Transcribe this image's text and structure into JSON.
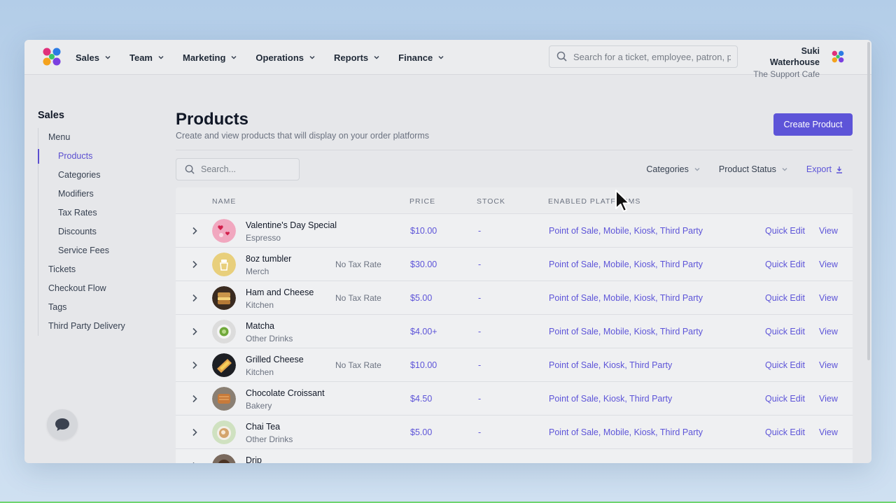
{
  "topbar": {
    "nav": [
      {
        "label": "Sales"
      },
      {
        "label": "Team"
      },
      {
        "label": "Marketing"
      },
      {
        "label": "Operations"
      },
      {
        "label": "Reports"
      },
      {
        "label": "Finance"
      }
    ],
    "search_placeholder": "Search for a ticket, employee, patron, p",
    "user_name": "Suki Waterhouse",
    "user_org": "The Support Cafe"
  },
  "sidebar": {
    "title": "Sales",
    "items": [
      {
        "label": "Menu"
      },
      {
        "label": "Products"
      },
      {
        "label": "Categories"
      },
      {
        "label": "Modifiers"
      },
      {
        "label": "Tax Rates"
      },
      {
        "label": "Discounts"
      },
      {
        "label": "Service Fees"
      },
      {
        "label": "Tickets"
      },
      {
        "label": "Checkout Flow"
      },
      {
        "label": "Tags"
      },
      {
        "label": "Third Party Delivery"
      }
    ],
    "active": "Products"
  },
  "main": {
    "title": "Products",
    "subtitle": "Create and view products that will display on your order platforms",
    "create_button": "Create Product",
    "search_placeholder": "Search...",
    "filters": {
      "categories": "Categories",
      "product_status": "Product Status",
      "export": "Export"
    },
    "table": {
      "headers": [
        "NAME",
        "PRICE",
        "STOCK",
        "ENABLED PLATFORMS"
      ],
      "rows": [
        {
          "name": "Valentine's Day Special",
          "category": "Espresso",
          "tax": "",
          "price": "$10.00",
          "stock": "-",
          "platforms": "Point of Sale, Mobile, Kiosk, Third Party",
          "quick_edit": "Quick Edit",
          "view": "View"
        },
        {
          "name": "8oz tumbler",
          "category": "Merch",
          "tax": "No Tax Rate",
          "price": "$30.00",
          "stock": "-",
          "platforms": "Point of Sale, Mobile, Kiosk, Third Party",
          "quick_edit": "Quick Edit",
          "view": "View"
        },
        {
          "name": "Ham and Cheese",
          "category": "Kitchen",
          "tax": "No Tax Rate",
          "price": "$5.00",
          "stock": "-",
          "platforms": "Point of Sale, Mobile, Kiosk, Third Party",
          "quick_edit": "Quick Edit",
          "view": "View"
        },
        {
          "name": "Matcha",
          "category": "Other Drinks",
          "tax": "",
          "price": "$4.00+",
          "stock": "-",
          "platforms": "Point of Sale, Mobile, Kiosk, Third Party",
          "quick_edit": "Quick Edit",
          "view": "View"
        },
        {
          "name": "Grilled Cheese",
          "category": "Kitchen",
          "tax": "No Tax Rate",
          "price": "$10.00",
          "stock": "-",
          "platforms": "Point of Sale, Kiosk, Third Party",
          "quick_edit": "Quick Edit",
          "view": "View"
        },
        {
          "name": "Chocolate Croissant",
          "category": "Bakery",
          "tax": "",
          "price": "$4.50",
          "stock": "-",
          "platforms": "Point of Sale, Kiosk, Third Party",
          "quick_edit": "Quick Edit",
          "view": "View"
        },
        {
          "name": "Chai Tea",
          "category": "Other Drinks",
          "tax": "",
          "price": "$5.00",
          "stock": "-",
          "platforms": "Point of Sale, Mobile, Kiosk, Third Party",
          "quick_edit": "Quick Edit",
          "view": "View"
        },
        {
          "name": "Drip",
          "category": "",
          "tax": "",
          "price": "",
          "stock": "",
          "platforms": "",
          "quick_edit": "",
          "view": ""
        }
      ]
    }
  },
  "colors": {
    "accent": "#5d54d8",
    "background_gradient_top": "#b3cde8",
    "window_bg": "#e6e7ea"
  },
  "icons": [
    "logo-icon",
    "chevron-down-icon",
    "search-icon",
    "download-icon",
    "chevron-right-icon",
    "chat-icon",
    "cursor-icon"
  ]
}
